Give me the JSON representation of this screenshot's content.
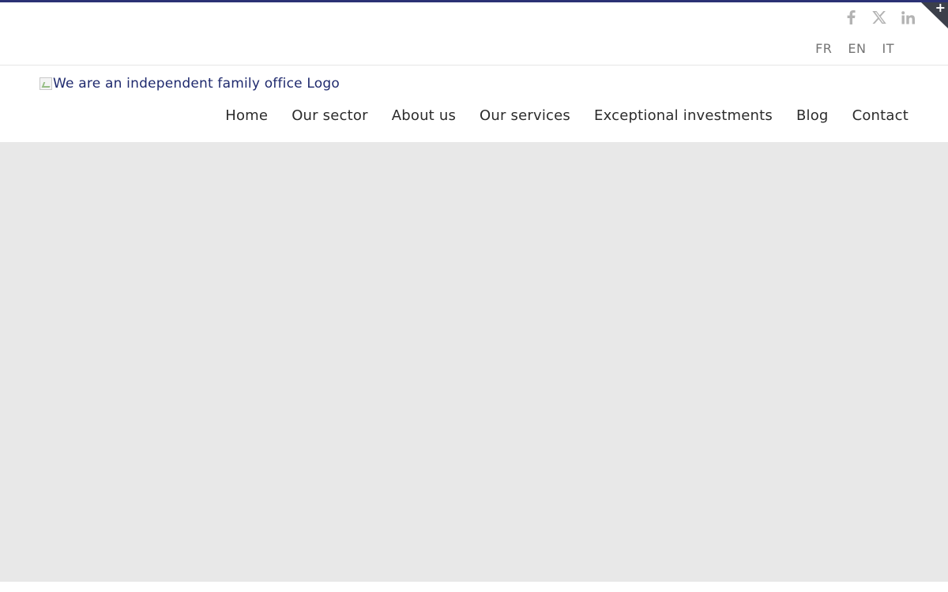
{
  "social": [
    {
      "name": "facebook-icon"
    },
    {
      "name": "x-twitter-icon"
    },
    {
      "name": "linkedin-icon"
    }
  ],
  "languages": [
    "FR",
    "EN",
    "IT"
  ],
  "logo": {
    "alt": "We are an independent family office Logo"
  },
  "nav": {
    "items": [
      "Home",
      "Our sector",
      "About us",
      "Our services",
      "Exceptional investments",
      "Blog",
      "Contact"
    ]
  },
  "corner_toggle": {
    "symbol": "+"
  },
  "colors": {
    "accent": "#2b3174",
    "logo_text": "#1f2a6e",
    "nav_text": "#2b2b2b",
    "social_icon": "#b3b3b3",
    "hero_bg": "#e8e8e8",
    "corner_bg": "#3b3f4a"
  }
}
